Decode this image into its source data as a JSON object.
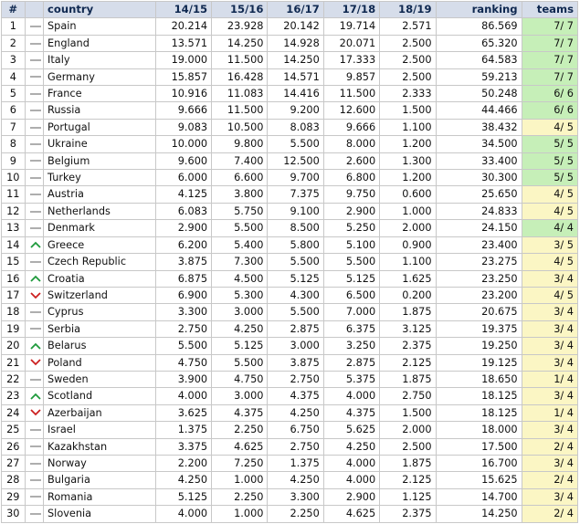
{
  "colors": {
    "header_bg": "#d6ddea",
    "header_text": "#0f2850",
    "teams_green": "#c6efb8",
    "teams_yellow": "#fbf6c4",
    "trend_up": "#1f9a3c",
    "trend_down": "#cc2020",
    "trend_same": "#9a9a9a"
  },
  "table": {
    "headers": {
      "num": "#",
      "country": "country",
      "y1415": "14/15",
      "y1516": "15/16",
      "y1617": "16/17",
      "y1718": "17/18",
      "y1819": "18/19",
      "ranking": "ranking",
      "teams": "teams"
    },
    "rows": [
      {
        "num": "1",
        "trend": "same",
        "country": "Spain",
        "y1415": "20.214",
        "y1516": "23.928",
        "y1617": "20.142",
        "y1718": "19.714",
        "y1819": "2.571",
        "ranking": "86.569",
        "teams": "7/ 7",
        "teams_color": "green"
      },
      {
        "num": "2",
        "trend": "same",
        "country": "England",
        "y1415": "13.571",
        "y1516": "14.250",
        "y1617": "14.928",
        "y1718": "20.071",
        "y1819": "2.500",
        "ranking": "65.320",
        "teams": "7/ 7",
        "teams_color": "green"
      },
      {
        "num": "3",
        "trend": "same",
        "country": "Italy",
        "y1415": "19.000",
        "y1516": "11.500",
        "y1617": "14.250",
        "y1718": "17.333",
        "y1819": "2.500",
        "ranking": "64.583",
        "teams": "7/ 7",
        "teams_color": "green"
      },
      {
        "num": "4",
        "trend": "same",
        "country": "Germany",
        "y1415": "15.857",
        "y1516": "16.428",
        "y1617": "14.571",
        "y1718": "9.857",
        "y1819": "2.500",
        "ranking": "59.213",
        "teams": "7/ 7",
        "teams_color": "green"
      },
      {
        "num": "5",
        "trend": "same",
        "country": "France",
        "y1415": "10.916",
        "y1516": "11.083",
        "y1617": "14.416",
        "y1718": "11.500",
        "y1819": "2.333",
        "ranking": "50.248",
        "teams": "6/ 6",
        "teams_color": "green"
      },
      {
        "num": "6",
        "trend": "same",
        "country": "Russia",
        "y1415": "9.666",
        "y1516": "11.500",
        "y1617": "9.200",
        "y1718": "12.600",
        "y1819": "1.500",
        "ranking": "44.466",
        "teams": "6/ 6",
        "teams_color": "green"
      },
      {
        "num": "7",
        "trend": "same",
        "country": "Portugal",
        "y1415": "9.083",
        "y1516": "10.500",
        "y1617": "8.083",
        "y1718": "9.666",
        "y1819": "1.100",
        "ranking": "38.432",
        "teams": "4/ 5",
        "teams_color": "yellow"
      },
      {
        "num": "8",
        "trend": "same",
        "country": "Ukraine",
        "y1415": "10.000",
        "y1516": "9.800",
        "y1617": "5.500",
        "y1718": "8.000",
        "y1819": "1.200",
        "ranking": "34.500",
        "teams": "5/ 5",
        "teams_color": "green"
      },
      {
        "num": "9",
        "trend": "same",
        "country": "Belgium",
        "y1415": "9.600",
        "y1516": "7.400",
        "y1617": "12.500",
        "y1718": "2.600",
        "y1819": "1.300",
        "ranking": "33.400",
        "teams": "5/ 5",
        "teams_color": "green"
      },
      {
        "num": "10",
        "trend": "same",
        "country": "Turkey",
        "y1415": "6.000",
        "y1516": "6.600",
        "y1617": "9.700",
        "y1718": "6.800",
        "y1819": "1.200",
        "ranking": "30.300",
        "teams": "5/ 5",
        "teams_color": "green"
      },
      {
        "num": "11",
        "trend": "same",
        "country": "Austria",
        "y1415": "4.125",
        "y1516": "3.800",
        "y1617": "7.375",
        "y1718": "9.750",
        "y1819": "0.600",
        "ranking": "25.650",
        "teams": "4/ 5",
        "teams_color": "yellow"
      },
      {
        "num": "12",
        "trend": "same",
        "country": "Netherlands",
        "y1415": "6.083",
        "y1516": "5.750",
        "y1617": "9.100",
        "y1718": "2.900",
        "y1819": "1.000",
        "ranking": "24.833",
        "teams": "4/ 5",
        "teams_color": "yellow"
      },
      {
        "num": "13",
        "trend": "same",
        "country": "Denmark",
        "y1415": "2.900",
        "y1516": "5.500",
        "y1617": "8.500",
        "y1718": "5.250",
        "y1819": "2.000",
        "ranking": "24.150",
        "teams": "4/ 4",
        "teams_color": "green"
      },
      {
        "num": "14",
        "trend": "up",
        "country": "Greece",
        "y1415": "6.200",
        "y1516": "5.400",
        "y1617": "5.800",
        "y1718": "5.100",
        "y1819": "0.900",
        "ranking": "23.400",
        "teams": "3/ 5",
        "teams_color": "yellow"
      },
      {
        "num": "15",
        "trend": "same",
        "country": "Czech Republic",
        "y1415": "3.875",
        "y1516": "7.300",
        "y1617": "5.500",
        "y1718": "5.500",
        "y1819": "1.100",
        "ranking": "23.275",
        "teams": "4/ 5",
        "teams_color": "yellow"
      },
      {
        "num": "16",
        "trend": "up",
        "country": "Croatia",
        "y1415": "6.875",
        "y1516": "4.500",
        "y1617": "5.125",
        "y1718": "5.125",
        "y1819": "1.625",
        "ranking": "23.250",
        "teams": "3/ 4",
        "teams_color": "yellow"
      },
      {
        "num": "17",
        "trend": "down",
        "country": "Switzerland",
        "y1415": "6.900",
        "y1516": "5.300",
        "y1617": "4.300",
        "y1718": "6.500",
        "y1819": "0.200",
        "ranking": "23.200",
        "teams": "4/ 5",
        "teams_color": "yellow"
      },
      {
        "num": "18",
        "trend": "same",
        "country": "Cyprus",
        "y1415": "3.300",
        "y1516": "3.000",
        "y1617": "5.500",
        "y1718": "7.000",
        "y1819": "1.875",
        "ranking": "20.675",
        "teams": "3/ 4",
        "teams_color": "yellow"
      },
      {
        "num": "19",
        "trend": "same",
        "country": "Serbia",
        "y1415": "2.750",
        "y1516": "4.250",
        "y1617": "2.875",
        "y1718": "6.375",
        "y1819": "3.125",
        "ranking": "19.375",
        "teams": "3/ 4",
        "teams_color": "yellow"
      },
      {
        "num": "20",
        "trend": "up",
        "country": "Belarus",
        "y1415": "5.500",
        "y1516": "5.125",
        "y1617": "3.000",
        "y1718": "3.250",
        "y1819": "2.375",
        "ranking": "19.250",
        "teams": "3/ 4",
        "teams_color": "yellow"
      },
      {
        "num": "21",
        "trend": "down",
        "country": "Poland",
        "y1415": "4.750",
        "y1516": "5.500",
        "y1617": "3.875",
        "y1718": "2.875",
        "y1819": "2.125",
        "ranking": "19.125",
        "teams": "3/ 4",
        "teams_color": "yellow"
      },
      {
        "num": "22",
        "trend": "same",
        "country": "Sweden",
        "y1415": "3.900",
        "y1516": "4.750",
        "y1617": "2.750",
        "y1718": "5.375",
        "y1819": "1.875",
        "ranking": "18.650",
        "teams": "1/ 4",
        "teams_color": "yellow"
      },
      {
        "num": "23",
        "trend": "up",
        "country": "Scotland",
        "y1415": "4.000",
        "y1516": "3.000",
        "y1617": "4.375",
        "y1718": "4.000",
        "y1819": "2.750",
        "ranking": "18.125",
        "teams": "3/ 4",
        "teams_color": "yellow"
      },
      {
        "num": "24",
        "trend": "down",
        "country": "Azerbaijan",
        "y1415": "3.625",
        "y1516": "4.375",
        "y1617": "4.250",
        "y1718": "4.375",
        "y1819": "1.500",
        "ranking": "18.125",
        "teams": "1/ 4",
        "teams_color": "yellow"
      },
      {
        "num": "25",
        "trend": "same",
        "country": "Israel",
        "y1415": "1.375",
        "y1516": "2.250",
        "y1617": "6.750",
        "y1718": "5.625",
        "y1819": "2.000",
        "ranking": "18.000",
        "teams": "3/ 4",
        "teams_color": "yellow"
      },
      {
        "num": "26",
        "trend": "same",
        "country": "Kazakhstan",
        "y1415": "3.375",
        "y1516": "4.625",
        "y1617": "2.750",
        "y1718": "4.250",
        "y1819": "2.500",
        "ranking": "17.500",
        "teams": "2/ 4",
        "teams_color": "yellow"
      },
      {
        "num": "27",
        "trend": "same",
        "country": "Norway",
        "y1415": "2.200",
        "y1516": "7.250",
        "y1617": "1.375",
        "y1718": "4.000",
        "y1819": "1.875",
        "ranking": "16.700",
        "teams": "3/ 4",
        "teams_color": "yellow"
      },
      {
        "num": "28",
        "trend": "same",
        "country": "Bulgaria",
        "y1415": "4.250",
        "y1516": "1.000",
        "y1617": "4.250",
        "y1718": "4.000",
        "y1819": "2.125",
        "ranking": "15.625",
        "teams": "2/ 4",
        "teams_color": "yellow"
      },
      {
        "num": "29",
        "trend": "same",
        "country": "Romania",
        "y1415": "5.125",
        "y1516": "2.250",
        "y1617": "3.300",
        "y1718": "2.900",
        "y1819": "1.125",
        "ranking": "14.700",
        "teams": "3/ 4",
        "teams_color": "yellow"
      },
      {
        "num": "30",
        "trend": "same",
        "country": "Slovenia",
        "y1415": "4.000",
        "y1516": "1.000",
        "y1617": "2.250",
        "y1718": "4.625",
        "y1819": "2.375",
        "ranking": "14.250",
        "teams": "2/ 4",
        "teams_color": "yellow"
      }
    ]
  }
}
